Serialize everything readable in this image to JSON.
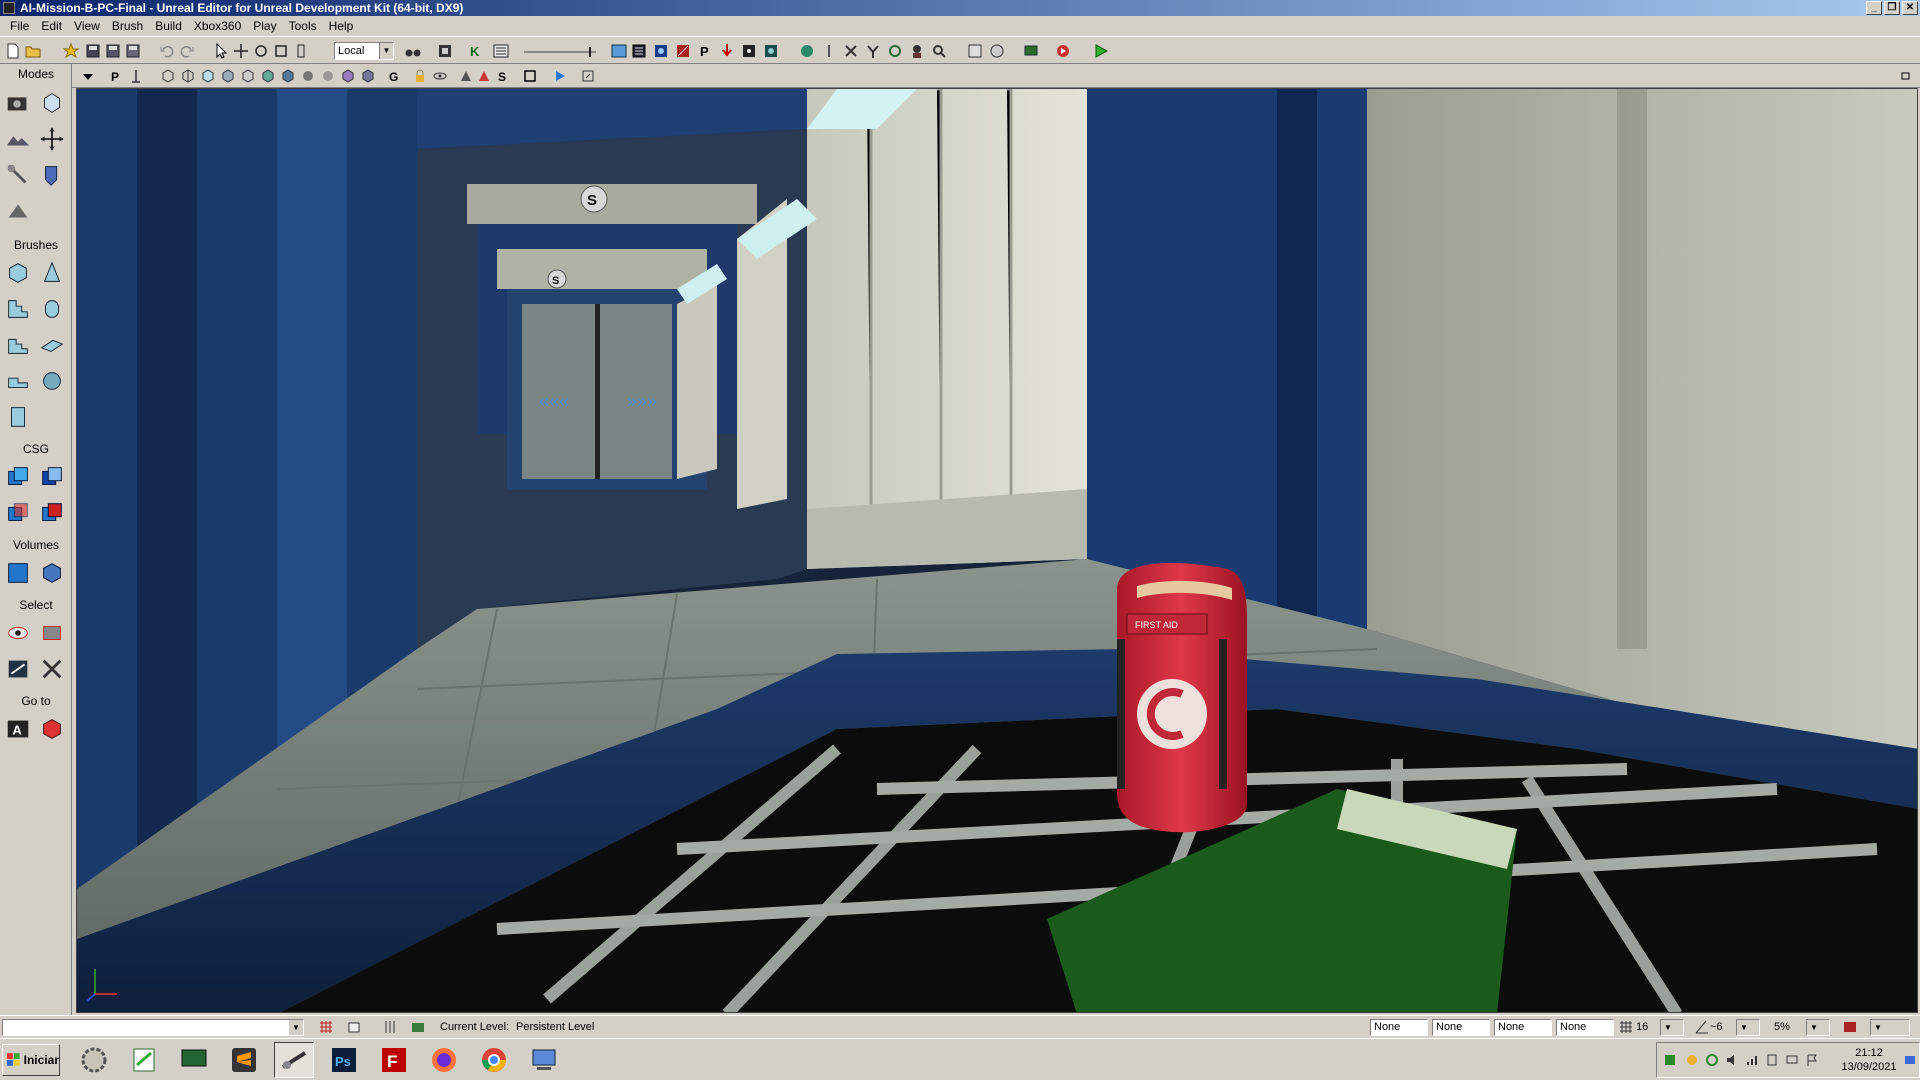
{
  "window": {
    "title": "AI-Mission-B-PC-Final - Unreal Editor for Unreal Development Kit (64-bit, DX9)"
  },
  "menu": {
    "items": [
      "File",
      "Edit",
      "View",
      "Brush",
      "Build",
      "Xbox360",
      "Play",
      "Tools",
      "Help"
    ]
  },
  "toolbar": {
    "coord_system": "Local"
  },
  "panel": {
    "modes": "Modes",
    "brushes": "Brushes",
    "csg": "CSG",
    "volumes": "Volumes",
    "select": "Select",
    "goto": "Go to"
  },
  "viewport": {
    "scene_description_icons": [
      "s-marker",
      "first-aid-kit",
      "floor-grate"
    ]
  },
  "pickup": {
    "label": "FIRST AID"
  },
  "status": {
    "current_level_label": "Current Level:",
    "current_level": "Persistent Level",
    "fields": [
      "None",
      "None",
      "None",
      "None"
    ],
    "grid": "16",
    "rotation": "~6",
    "scale": "5%"
  },
  "taskbar": {
    "start": "Iniciar",
    "time": "21:12",
    "date": "13/09/2021"
  },
  "colors": {
    "title_start": "#0a246a",
    "title_end": "#a6caf0",
    "chrome": "#d4d0c8",
    "wall_blue": "#1e3f72",
    "medkit_red": "#d42a3a"
  }
}
